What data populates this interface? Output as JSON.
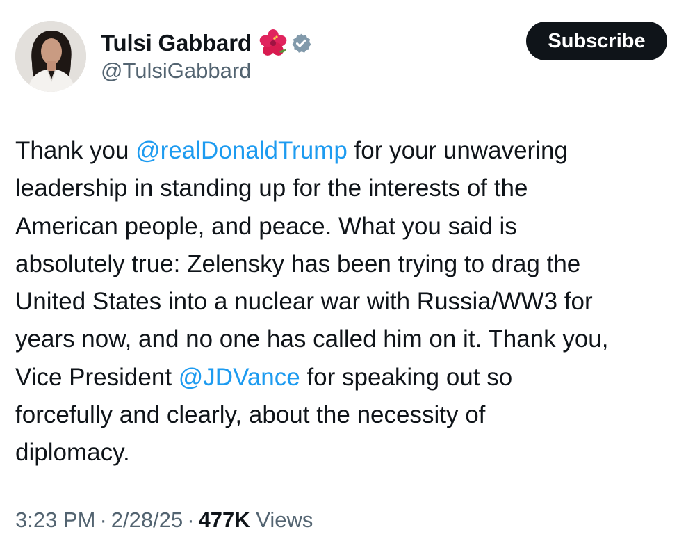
{
  "author": {
    "display_name": "Tulsi Gabbard",
    "handle": "@TulsiGabbard",
    "emoji_icon": "hibiscus-icon",
    "verified_icon": "verified-badge-icon"
  },
  "subscribe_label": "Subscribe",
  "tweet": {
    "lines": [
      {
        "pre": "Thank you ",
        "mention": "@realDonaldTrump",
        "post": " for your unwavering"
      },
      {
        "pre": "leadership in standing up for the interests of the",
        "mention": "",
        "post": ""
      },
      {
        "pre": "American people, and peace. What you said is",
        "mention": "",
        "post": ""
      },
      {
        "pre": "absolutely true: Zelensky has been trying to drag the",
        "mention": "",
        "post": ""
      },
      {
        "pre": "United States into a nuclear war with Russia/WW3 for",
        "mention": "",
        "post": ""
      },
      {
        "pre": "years now, and no one has called him on it. Thank you,",
        "mention": "",
        "post": ""
      },
      {
        "pre": "Vice President ",
        "mention": "@JDVance",
        "post": " for speaking out so"
      },
      {
        "pre": "forcefully and clearly, about the necessity of",
        "mention": "",
        "post": ""
      },
      {
        "pre": "diplomacy.",
        "mention": "",
        "post": ""
      }
    ]
  },
  "meta": {
    "time": "3:23 PM",
    "date": "2/28/25",
    "views_count": "477K",
    "views_label": "Views",
    "separator": "·"
  },
  "colors": {
    "mention": "#1d9bf0",
    "secondary_text": "#536471",
    "primary_text": "#0f1419",
    "button_bg": "#0f1419",
    "verified": "#829aab"
  }
}
